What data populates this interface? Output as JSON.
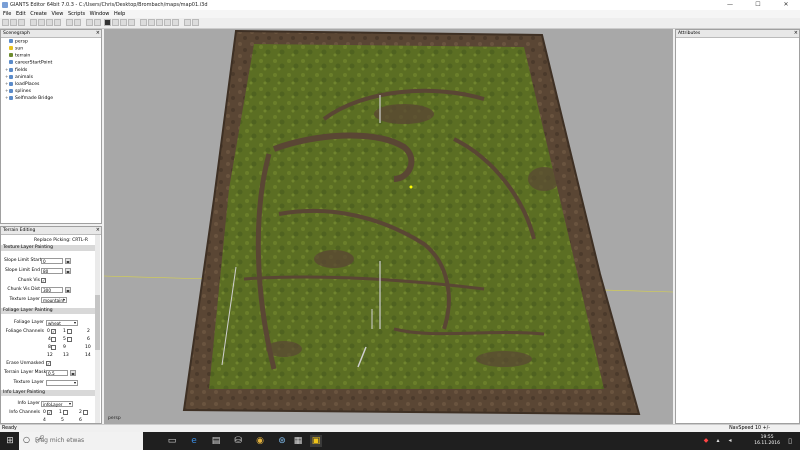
{
  "window": {
    "title": "GIANTS Editor 64bit 7.0.3 - C:/Users/Chris/Desktop/Brombach/maps/map01.i3d",
    "minimize": "—",
    "maximize": "☐",
    "close": "✕"
  },
  "menu": [
    "File",
    "Edit",
    "Create",
    "View",
    "Scripts",
    "Window",
    "Help"
  ],
  "scenegraph": {
    "title": "Scenegraph",
    "items": [
      {
        "label": "persp",
        "expand": ""
      },
      {
        "label": "sun",
        "expand": ""
      },
      {
        "label": "terrain",
        "expand": ""
      },
      {
        "label": "careerStartPoint",
        "expand": ""
      },
      {
        "label": "fields",
        "expand": "+"
      },
      {
        "label": "animals",
        "expand": "+"
      },
      {
        "label": "loadPlaces",
        "expand": "+"
      },
      {
        "label": "splines",
        "expand": "+"
      },
      {
        "label": "Selfmade Bridge",
        "expand": "+"
      }
    ]
  },
  "terrain_editing": {
    "title": "Terrain Editing",
    "replace_picking": "Replace Picking: CRTL-R",
    "texture_section": "Texture Layer Painting",
    "slope_start_label": "Slope Limit Start",
    "slope_start_value": "0",
    "slope_end_label": "Slope Limit End",
    "slope_end_value": "80",
    "chunk_vis_label": "Chunk Vis",
    "chunk_vis_dist_label": "Chunk Vis Dist",
    "chunk_vis_dist_value": "300",
    "texture_layer_label": "Texture Layer",
    "texture_layer_value": "mountainl",
    "foliage_section": "Foliage Layer Painting",
    "foliage_layer_label": "Foliage Layer",
    "foliage_layer_value": "wheat",
    "foliage_channels_label": "Foliage Channels",
    "foliage_channels": [
      "0",
      "1",
      "2",
      "4",
      "5",
      "6",
      "8",
      "9",
      "10",
      "12",
      "13",
      "14"
    ],
    "erase_unmasked_label": "Erase Unmasked",
    "terrain_mask_label": "Terrain Layer Mask",
    "terrain_mask_value": "0.5",
    "texture_layer2_label": "Texture Layer",
    "info_section": "Info Layer Painting",
    "info_layer_label": "Info Layer",
    "info_layer_value": "infoLayer",
    "info_channels_label": "Info Channels",
    "info_channels": [
      "0",
      "1",
      "2",
      "4",
      "5",
      "6"
    ]
  },
  "viewport": {
    "label": "persp"
  },
  "attributes": {
    "title": "Attributes"
  },
  "status": {
    "left": "Ready",
    "right": "NavSpeed 10 +/-"
  },
  "taskbar": {
    "search_placeholder": "Frag mich etwas",
    "time": "19:55",
    "date": "16.11.2016"
  },
  "colors": {
    "grass": "#5b6e23",
    "soil": "#5a4634",
    "viewport_bg": "#a8a8a8",
    "taskbar": "#1f1f1f"
  }
}
